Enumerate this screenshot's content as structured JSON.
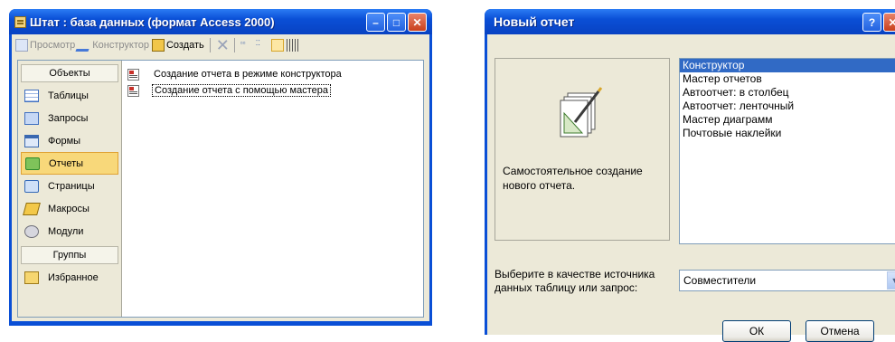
{
  "db_window": {
    "title": "Штат : база данных (формат Access 2000)",
    "toolbar": {
      "preview": "Просмотр",
      "design": "Конструктор",
      "create": "Создать"
    },
    "objects_header": "Объекты",
    "objects": [
      {
        "label": "Таблицы",
        "icon": "tables-icon"
      },
      {
        "label": "Запросы",
        "icon": "queries-icon"
      },
      {
        "label": "Формы",
        "icon": "forms-icon"
      },
      {
        "label": "Отчеты",
        "icon": "reports-icon",
        "selected": true
      },
      {
        "label": "Страницы",
        "icon": "pages-icon"
      },
      {
        "label": "Макросы",
        "icon": "macros-icon"
      },
      {
        "label": "Модули",
        "icon": "modules-icon"
      }
    ],
    "groups_header": "Группы",
    "groups": [
      {
        "label": "Избранное",
        "icon": "favorites-icon"
      }
    ],
    "list": [
      "Создание отчета в режиме конструктора",
      "Создание отчета с помощью мастера"
    ]
  },
  "dialog": {
    "title": "Новый отчет",
    "description": "Самостоятельное создание нового отчета.",
    "options": [
      "Конструктор",
      "Мастер отчетов",
      "Автоотчет: в столбец",
      "Автоотчет: ленточный",
      "Мастер диаграмм",
      "Почтовые наклейки"
    ],
    "selected_option": "Конструктор",
    "source_label": "Выберите в качестве источника данных таблицу или запрос:",
    "source_value": "Совместители",
    "ok_label": "ОК",
    "cancel_label": "Отмена"
  },
  "colors": {
    "titlebar": "#0a4fd6",
    "client": "#ece9d8",
    "selection": "#316ac5",
    "selected_object": "#f8d87a"
  }
}
